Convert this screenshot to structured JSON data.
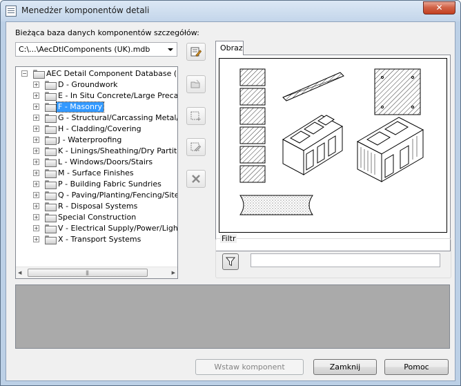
{
  "window": {
    "title": "Menedżer komponentów detali",
    "close_glyph": "✕"
  },
  "db": {
    "label": "Bieżąca baza danych komponentów szczegółów:",
    "value": "C:\\...\\AecDtlComponents (UK).mdb"
  },
  "tree": {
    "root": "AEC Detail Component Database (UK)",
    "items": [
      {
        "label": "D - Groundwork"
      },
      {
        "label": "E - In Situ Concrete/Large Precast C"
      },
      {
        "label": "F - Masonry",
        "selected": true
      },
      {
        "label": "G - Structural/Carcassing Metal/Tim"
      },
      {
        "label": "H - Cladding/Covering"
      },
      {
        "label": "J - Waterproofing"
      },
      {
        "label": "K - Linings/Sheathing/Dry Partitionir"
      },
      {
        "label": "L - Windows/Doors/Stairs"
      },
      {
        "label": "M - Surface Finishes"
      },
      {
        "label": "P - Building Fabric Sundries"
      },
      {
        "label": "Q - Paving/Planting/Fencing/Site Fu"
      },
      {
        "label": "R - Disposal Systems"
      },
      {
        "label": "Special Construction"
      },
      {
        "label": "V - Electrical Supply/Power/Lighting"
      },
      {
        "label": "X - Transport Systems"
      }
    ],
    "expander_glyph": "+",
    "root_expander_glyph": "−",
    "scroll_left": "◀",
    "scroll_right": "▶",
    "scroll_grip": "|||"
  },
  "toolbar": {
    "icons": [
      "edit-database-icon",
      "open-folder-icon",
      "new-component-icon",
      "edit-component-icon",
      "delete-icon"
    ]
  },
  "tabs": [
    {
      "label": "Obraz"
    }
  ],
  "filter": {
    "label": "Filtr",
    "value": "",
    "icon": "funnel-icon"
  },
  "buttons": {
    "insert": "Wstaw komponent",
    "close": "Zamknij",
    "help": "Pomoc"
  },
  "colors": {
    "selection": "#3399ff",
    "description_area": "#aaaaaa",
    "close_button": "#c94d30"
  }
}
